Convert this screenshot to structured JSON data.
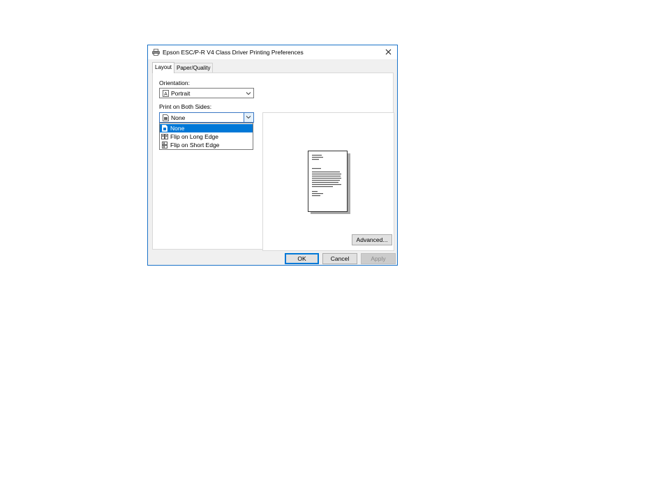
{
  "window": {
    "title": "Epson ESC/P-R V4 Class Driver Printing Preferences",
    "app_icon": "printer-icon",
    "close_icon": "close-icon"
  },
  "tabs": [
    {
      "label": "Layout",
      "active": true
    },
    {
      "label": "Paper/Quality",
      "active": false
    }
  ],
  "orientation": {
    "label": "Orientation:",
    "value": "Portrait",
    "icon": "portrait-page-icon"
  },
  "both_sides": {
    "label": "Print on Both Sides:",
    "value": "None",
    "icon": "single-page-icon",
    "expanded": true,
    "options": [
      {
        "label": "None",
        "icon": "single-page-icon",
        "selected": true
      },
      {
        "label": "Flip on Long Edge",
        "icon": "flip-long-edge-icon",
        "selected": false
      },
      {
        "label": "Flip on Short Edge",
        "icon": "flip-short-edge-icon",
        "selected": false
      }
    ]
  },
  "preview": {
    "icon": "document-preview-icon"
  },
  "buttons": {
    "advanced": "Advanced...",
    "ok": "OK",
    "cancel": "Cancel",
    "apply": "Apply"
  },
  "colors": {
    "accent": "#0078d7",
    "window_border": "#1a73c9",
    "dialog_bg": "#f0f0f0"
  }
}
